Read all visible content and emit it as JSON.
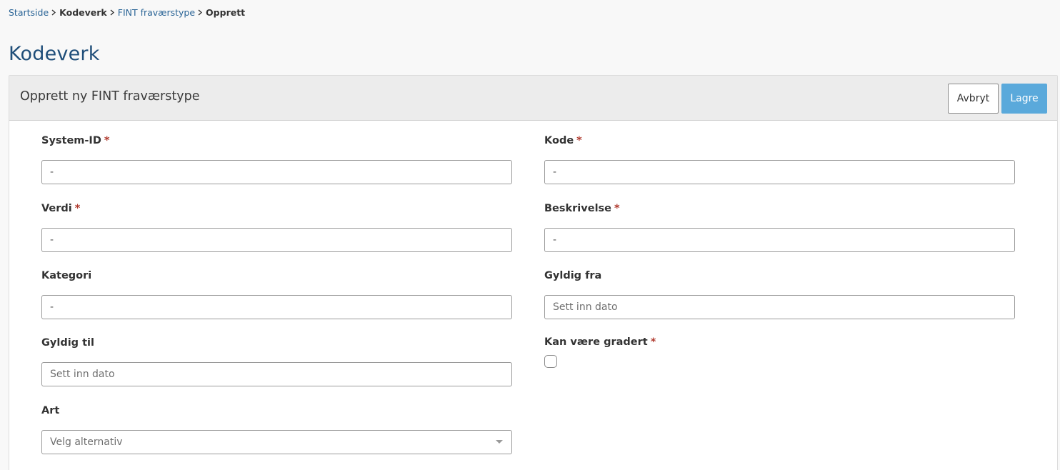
{
  "breadcrumb": {
    "items": [
      "Startside",
      "Kodeverk",
      "FINT fraværstype",
      "Opprett"
    ]
  },
  "page": {
    "title": "Kodeverk"
  },
  "form": {
    "title": "Opprett ny FINT fraværstype",
    "cancel_label": "Avbryt",
    "save_label": "Lagre",
    "required_mark": "*",
    "fields": {
      "system_id": {
        "label": "System-ID",
        "value": "-",
        "required": true
      },
      "kode": {
        "label": "Kode",
        "value": "-",
        "required": true
      },
      "verdi": {
        "label": "Verdi",
        "value": "-",
        "required": true
      },
      "beskrivelse": {
        "label": "Beskrivelse",
        "value": "-",
        "required": true
      },
      "kategori": {
        "label": "Kategori",
        "value": "-",
        "required": false
      },
      "gyldig_fra": {
        "label": "Gyldig fra",
        "placeholder": "Sett inn dato",
        "required": false
      },
      "gyldig_til": {
        "label": "Gyldig til",
        "placeholder": "Sett inn dato",
        "required": false
      },
      "kan_vaere_gradert": {
        "label": "Kan være gradert",
        "checked": false,
        "required": true
      },
      "art": {
        "label": "Art",
        "placeholder": "Velg alternativ",
        "required": false
      }
    }
  },
  "colors": {
    "link": "#2a6496",
    "title": "#1f4e79",
    "primary_button": "#5aa9db",
    "required": "#b03a2e"
  }
}
